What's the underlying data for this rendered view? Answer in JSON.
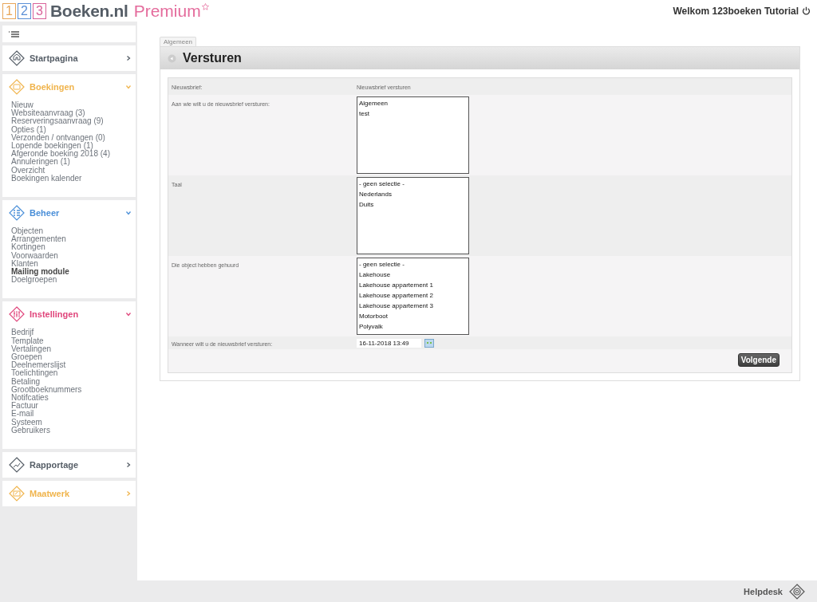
{
  "header": {
    "logo_digits": [
      {
        "text": "1",
        "color": "#e8a65a"
      },
      {
        "text": "2",
        "color": "#5b8fd6"
      },
      {
        "text": "3",
        "color": "#d9629a"
      }
    ],
    "logo_name": "Boeken.nl",
    "logo_tier": "Premium",
    "welcome": "Welkom 123boeken Tutorial"
  },
  "sidebar": {
    "sections": [
      {
        "title": "Startpagina",
        "color": "#555d66",
        "expanded": false
      },
      {
        "title": "Boekingen",
        "color": "#f0b44c",
        "expanded": true,
        "links": [
          {
            "label": "Nieuw",
            "active": false
          },
          {
            "label": "Websiteaanvraag (3)",
            "active": false
          },
          {
            "label": "Reserveringsaanvraag (9)",
            "active": false
          },
          {
            "label": "Opties (1)",
            "active": false
          },
          {
            "label": "Verzonden / ontvangen (0)",
            "active": false
          },
          {
            "label": "Lopende boekingen (1)",
            "active": false
          },
          {
            "label": "Afgeronde boeking 2018 (4)",
            "active": false
          },
          {
            "label": "Annuleringen (1)",
            "active": false
          },
          {
            "label": "Overzicht",
            "active": false
          },
          {
            "label": "Boekingen kalender",
            "active": false
          }
        ]
      },
      {
        "title": "Beheer",
        "color": "#4a8fd8",
        "expanded": true,
        "links": [
          {
            "label": "Objecten",
            "active": false
          },
          {
            "label": "Arrangementen",
            "active": false
          },
          {
            "label": "Kortingen",
            "active": false
          },
          {
            "label": "Voorwaarden",
            "active": false
          },
          {
            "label": "Klanten",
            "active": false
          },
          {
            "label": "Mailing module",
            "active": true
          },
          {
            "label": "Doelgroepen",
            "active": false
          }
        ]
      },
      {
        "title": "Instellingen",
        "color": "#e0457b",
        "expanded": true,
        "links": [
          {
            "label": "Bedrijf",
            "active": false
          },
          {
            "label": "Template",
            "active": false
          },
          {
            "label": "Vertalingen",
            "active": false
          },
          {
            "label": "Groepen",
            "active": false
          },
          {
            "label": "Deelnemerslijst",
            "active": false
          },
          {
            "label": "Toelichtingen",
            "active": false
          },
          {
            "label": "Betaling",
            "active": false
          },
          {
            "label": "Grootboeknummers",
            "active": false
          },
          {
            "label": "Notifcaties",
            "active": false
          },
          {
            "label": "Factuur",
            "active": false
          },
          {
            "label": "E-mail",
            "active": false
          },
          {
            "label": "Systeem",
            "active": false
          },
          {
            "label": "Gebruikers",
            "active": false
          }
        ]
      },
      {
        "title": "Rapportage",
        "color": "#555d66",
        "expanded": false
      },
      {
        "title": "Maatwerk",
        "color": "#f0b44c",
        "expanded": false
      }
    ]
  },
  "tabs": [
    {
      "label": "Algemeen",
      "selected": true
    }
  ],
  "panel": {
    "title": "Versturen"
  },
  "form": {
    "rows": [
      {
        "kind": "text",
        "label": "Nieuwsbrief:",
        "value": "Nieuwsbrief versturen"
      },
      {
        "kind": "listbox",
        "label": "Aan wie wilt u de nieuwsbrief versturen:",
        "options": [
          "Algemeen",
          "test"
        ]
      },
      {
        "kind": "listbox",
        "label": "Taal",
        "options": [
          "- geen selectie -",
          "Nederlands",
          "Duits"
        ]
      },
      {
        "kind": "listbox",
        "label": "Die object hebben gehuurd",
        "options": [
          "- geen selectie -",
          "Lakehouse",
          "Lakehouse appartement 1",
          "Lakehouse appartement 2",
          "Lakehouse appartement 3",
          "Motorboot",
          "Polyvalk"
        ]
      },
      {
        "kind": "datetime",
        "label": "Wanneer wilt u de nieuwsbrief versturen:",
        "value": "16-11-2018 13:49"
      }
    ],
    "submit": "Volgende"
  },
  "footer": {
    "helpdesk": "Helpdesk"
  }
}
